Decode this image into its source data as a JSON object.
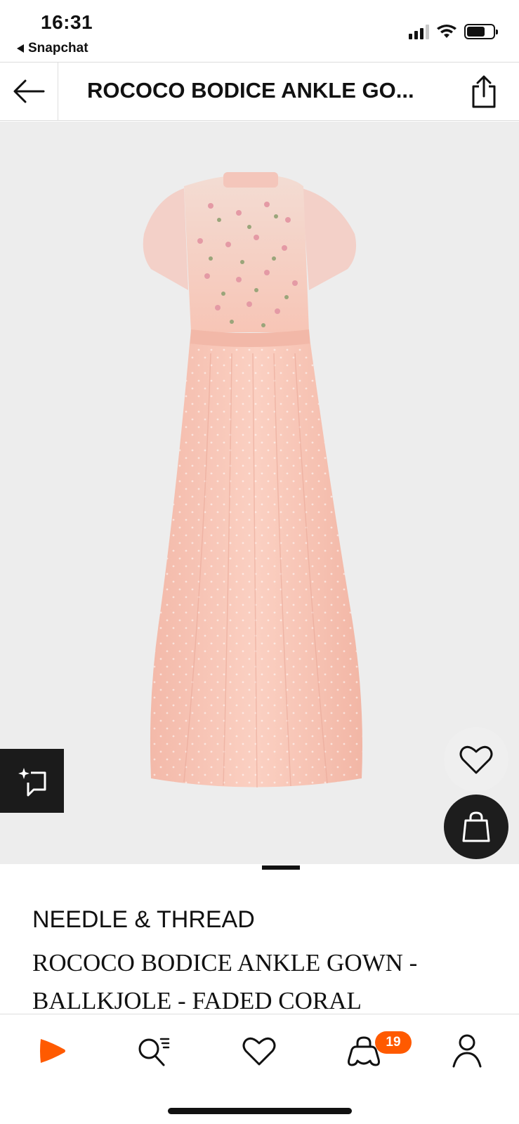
{
  "status_bar": {
    "time": "16:31",
    "back_app": "Snapchat",
    "icons": [
      "signal-icon",
      "wifi-icon",
      "battery-icon"
    ]
  },
  "header": {
    "title": "ROCOCO BODICE ANKLE GO...",
    "icons": [
      "arrow-left-icon",
      "share-icon"
    ]
  },
  "product_image": {
    "colors": {
      "background": "#ededed",
      "dress": "#f7c6b7"
    },
    "icons": [
      "compare-icon",
      "heart-icon",
      "bag-icon"
    ]
  },
  "product": {
    "brand": "NEEDLE & THREAD",
    "name": "ROCOCO BODICE ANKLE GOWN - BALLKJOLE - FADED CORAL"
  },
  "bottom_nav": {
    "items": [
      "home-icon",
      "search-icon",
      "heart-icon",
      "cart-icon",
      "profile-icon"
    ],
    "cart_count": "19",
    "accent": "#ff5a00"
  }
}
